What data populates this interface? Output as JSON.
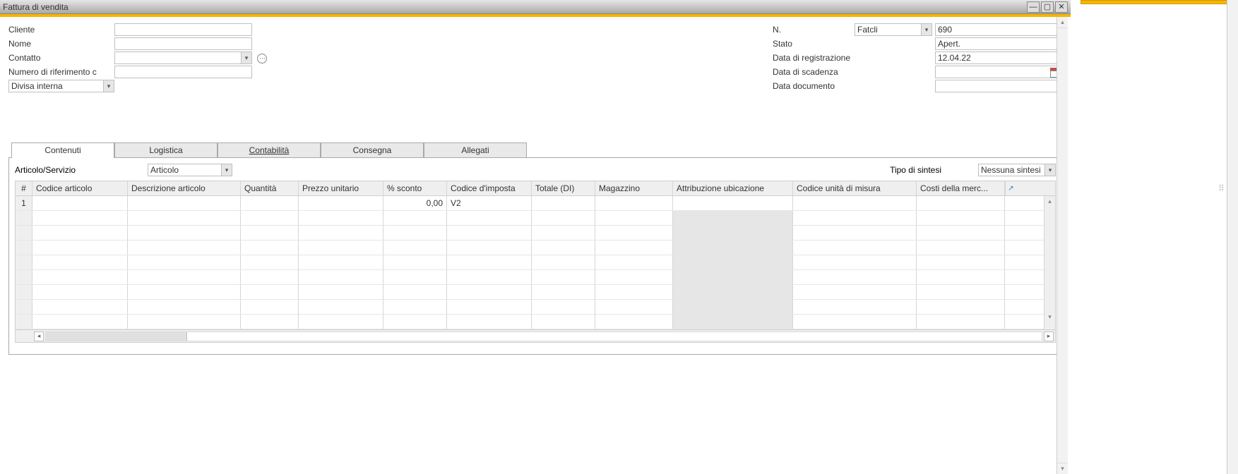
{
  "window": {
    "title": "Fattura di vendita"
  },
  "left_form": {
    "cliente_label": "Cliente",
    "cliente_value": "",
    "nome_label": "Nome",
    "nome_value": "",
    "contatto_label": "Contatto",
    "contatto_value": "",
    "numero_rif_label": "Numero di riferimento c",
    "numero_rif_value": "",
    "divisa_label": "Divisa interna"
  },
  "right_form": {
    "n_label": "N.",
    "n_type": "Fatcli",
    "n_value": "690",
    "stato_label": "Stato",
    "stato_value": "Apert.",
    "data_reg_label": "Data di registrazione",
    "data_reg_value": "12.04.22",
    "data_scad_label": "Data di scadenza",
    "data_scad_value": "",
    "data_doc_label": "Data documento",
    "data_doc_value": ""
  },
  "tabs": {
    "contenuti": "Contenuti",
    "logistica": "Logistica",
    "contabilita": "Contabilità",
    "consegna": "Consegna",
    "allegati": "Allegati"
  },
  "panel": {
    "articolo_servizio_label": "Articolo/Servizio",
    "articolo_servizio_value": "Articolo",
    "tipo_sintesi_label": "Tipo di sintesi",
    "tipo_sintesi_value": "Nessuna sintesi"
  },
  "grid": {
    "headers": {
      "rownum": "#",
      "codice_articolo": "Codice articolo",
      "descrizione": "Descrizione articolo",
      "quantita": "Quantità",
      "prezzo_unitario": "Prezzo unitario",
      "pct_sconto": "% sconto",
      "codice_imposta": "Codice d'imposta",
      "totale_di": "Totale (DI)",
      "magazzino": "Magazzino",
      "attribuzione_ubicazione": "Attribuzione ubicazione",
      "codice_um": "Codice unità di misura",
      "costi_merc": "Costi della merc..."
    },
    "row1": {
      "num": "1",
      "pct_sconto": "0,00",
      "codice_imposta": "V2"
    }
  }
}
